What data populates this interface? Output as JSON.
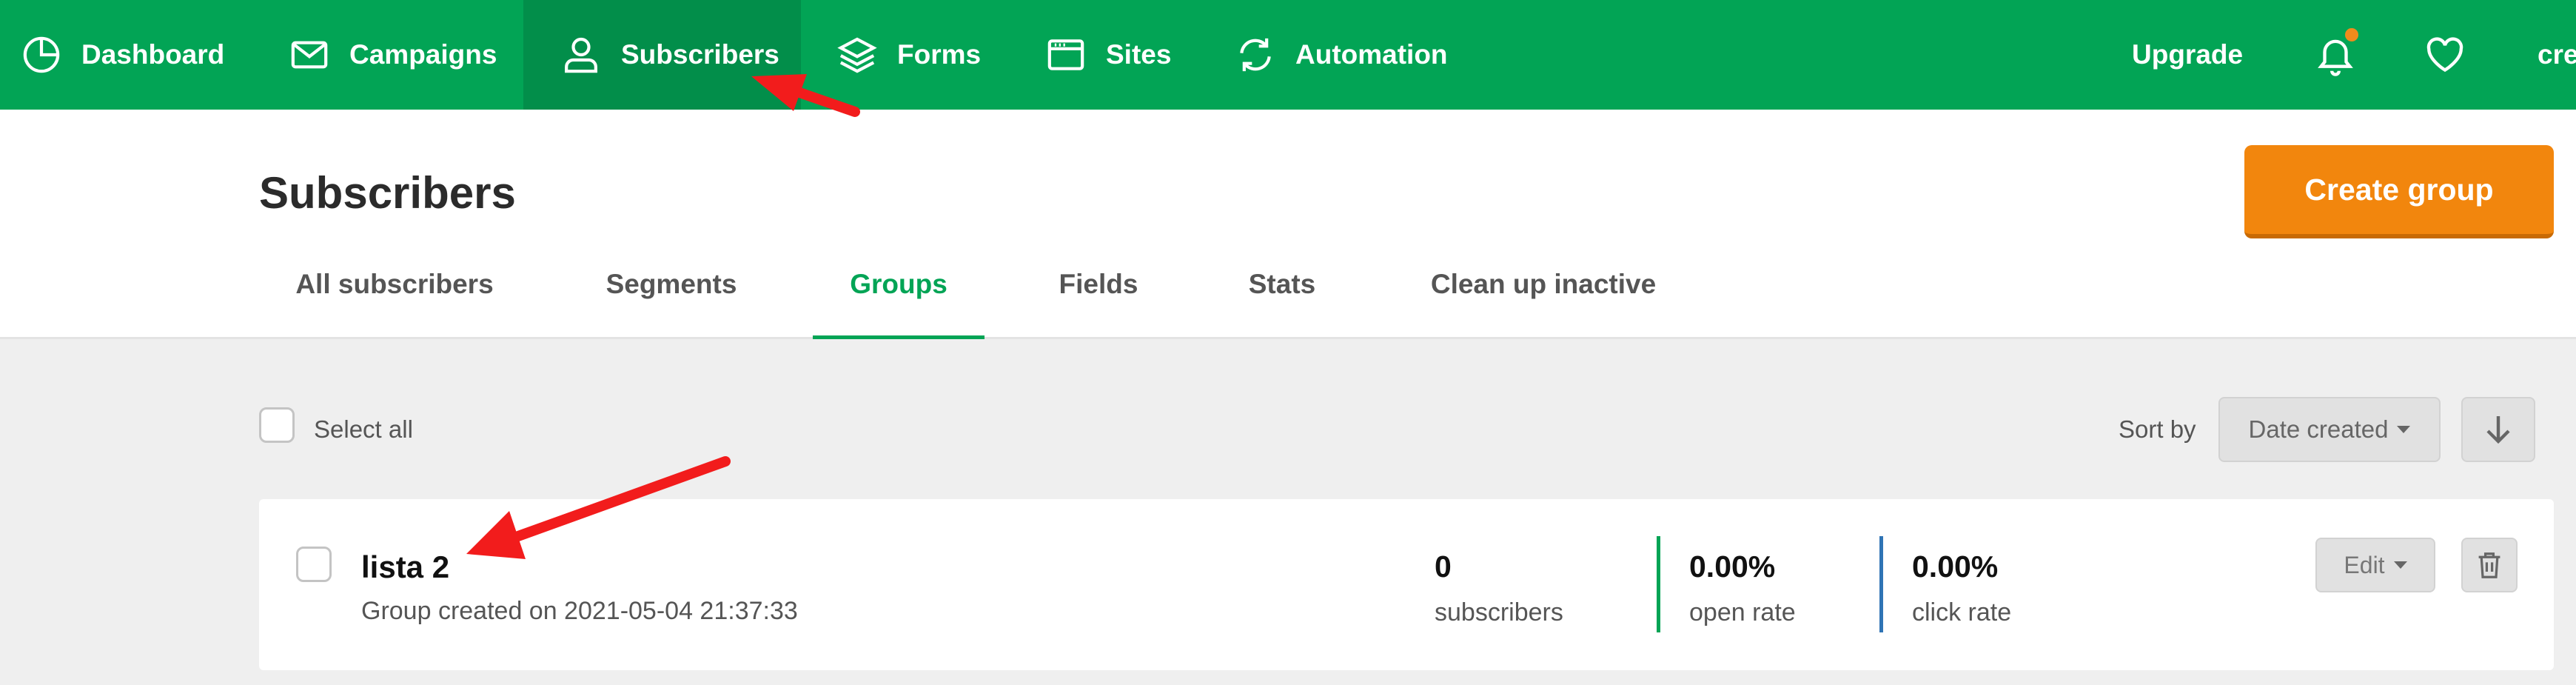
{
  "nav": {
    "items": [
      {
        "label": "Dashboard",
        "icon": "dashboard-icon"
      },
      {
        "label": "Campaigns",
        "icon": "envelope-icon"
      },
      {
        "label": "Subscribers",
        "icon": "user-icon",
        "active": true
      },
      {
        "label": "Forms",
        "icon": "layers-icon"
      },
      {
        "label": "Sites",
        "icon": "browser-icon"
      },
      {
        "label": "Automation",
        "icon": "refresh-icon"
      }
    ],
    "upgrade_label": "Upgrade",
    "account_label": "cre"
  },
  "page": {
    "title": "Subscribers",
    "create_button": "Create group"
  },
  "tabs": [
    {
      "label": "All subscribers"
    },
    {
      "label": "Segments"
    },
    {
      "label": "Groups",
      "active": true
    },
    {
      "label": "Fields"
    },
    {
      "label": "Stats"
    },
    {
      "label": "Clean up inactive"
    }
  ],
  "list_controls": {
    "select_all": "Select all",
    "sort_by_label": "Sort by",
    "sort_value": "Date created"
  },
  "groups": [
    {
      "name": "lista 2",
      "created": "Group created on 2021-05-04 21:37:33",
      "subscribers_value": "0",
      "subscribers_label": "subscribers",
      "open_rate_value": "0.00%",
      "open_rate_label": "open rate",
      "click_rate_value": "0.00%",
      "click_rate_label": "click rate",
      "edit_label": "Edit"
    }
  ],
  "colors": {
    "brand_green": "#02a455",
    "active_nav": "#028e4a",
    "cta_orange": "#f2860d",
    "open_rate_bar": "#02a455",
    "click_rate_bar": "#2f74b5",
    "annotation_arrow": "#f21c1c",
    "notification_dot": "#f08b1c"
  }
}
